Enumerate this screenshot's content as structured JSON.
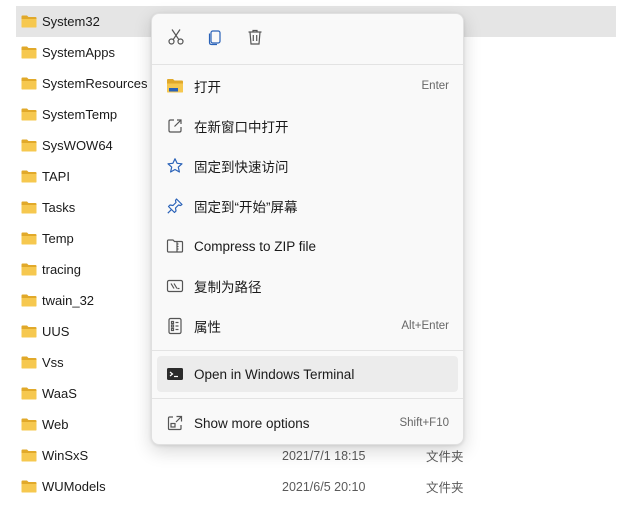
{
  "colors": {
    "folder": "#f3c14a",
    "folder_dark": "#e1a92a",
    "icon_blue": "#2a62b8",
    "icon_gray": "#555555",
    "selected_row": "#e5e5e5",
    "menu_bg": "#f9f9f9"
  },
  "files": [
    {
      "name": "System32",
      "date": "",
      "type": ""
    },
    {
      "name": "SystemApps",
      "date": "",
      "type": ""
    },
    {
      "name": "SystemResources",
      "date": "",
      "type": ""
    },
    {
      "name": "SystemTemp",
      "date": "",
      "type": ""
    },
    {
      "name": "SysWOW64",
      "date": "",
      "type": ""
    },
    {
      "name": "TAPI",
      "date": "",
      "type": ""
    },
    {
      "name": "Tasks",
      "date": "",
      "type": ""
    },
    {
      "name": "Temp",
      "date": "",
      "type": ""
    },
    {
      "name": "tracing",
      "date": "",
      "type": ""
    },
    {
      "name": "twain_32",
      "date": "",
      "type": ""
    },
    {
      "name": "UUS",
      "date": "",
      "type": ""
    },
    {
      "name": "Vss",
      "date": "",
      "type": ""
    },
    {
      "name": "WaaS",
      "date": "",
      "type": ""
    },
    {
      "name": "Web",
      "date": "",
      "type": ""
    },
    {
      "name": "WinSxS",
      "date": "2021/7/1 18:15",
      "type": "文件夹"
    },
    {
      "name": "WUModels",
      "date": "2021/6/5 20:10",
      "type": "文件夹"
    }
  ],
  "context_menu": {
    "quick_actions": [
      {
        "icon": "cut-icon"
      },
      {
        "icon": "copy-icon"
      },
      {
        "icon": "delete-icon"
      }
    ],
    "items": [
      {
        "label": "打开",
        "shortcut": "Enter",
        "icon": "folder-open-icon"
      },
      {
        "label": "在新窗口中打开",
        "shortcut": "",
        "icon": "open-new-window-icon"
      },
      {
        "label": "固定到快速访问",
        "shortcut": "",
        "icon": "star-icon"
      },
      {
        "label": "固定到“开始”屏幕",
        "shortcut": "",
        "icon": "pin-icon"
      },
      {
        "label": "Compress to ZIP file",
        "shortcut": "",
        "icon": "zip-folder-icon"
      },
      {
        "label": "复制为路径",
        "shortcut": "",
        "icon": "copy-path-icon"
      },
      {
        "label": "属性",
        "shortcut": "Alt+Enter",
        "icon": "properties-icon"
      },
      {
        "label": "Open in Windows Terminal",
        "shortcut": "",
        "icon": "terminal-icon"
      },
      {
        "label": "Show more options",
        "shortcut": "Shift+F10",
        "icon": "show-more-icon"
      }
    ]
  }
}
